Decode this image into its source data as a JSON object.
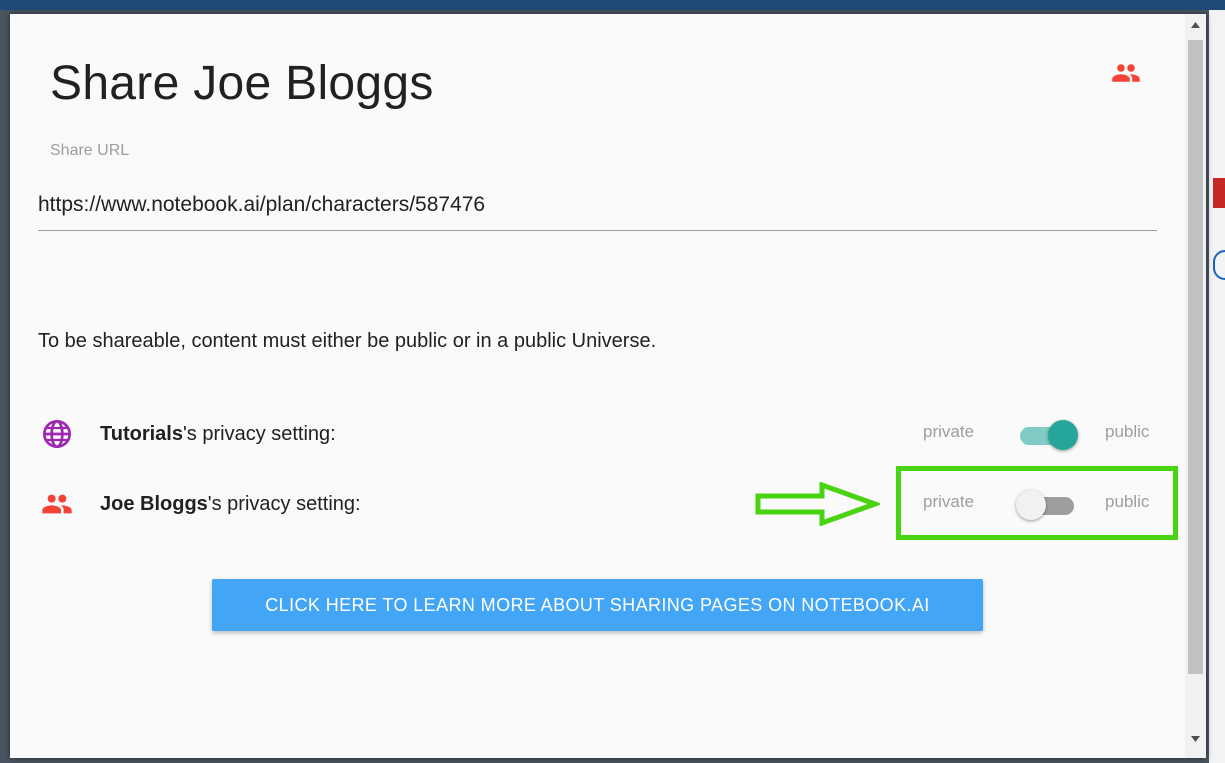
{
  "modal": {
    "title": "Share Joe Bloggs",
    "header_icon": "people-icon",
    "share_url_label": "Share URL",
    "share_url_value": "https://www.notebook.ai/plan/characters/587476",
    "notice": "To be shareable, content must either be public or in a public Universe.",
    "rows": [
      {
        "icon": "globe-icon",
        "name": "Tutorials",
        "suffix": "'s privacy setting:",
        "private_label": "private",
        "public_label": "public",
        "state": "public"
      },
      {
        "icon": "people-icon",
        "name": "Joe Bloggs",
        "suffix": "'s privacy setting:",
        "private_label": "private",
        "public_label": "public",
        "state": "private"
      }
    ],
    "learn_button": "CLICK HERE TO LEARN MORE ABOUT SHARING PAGES ON NOTEBOOK.AI"
  },
  "colors": {
    "accent_teal": "#26a69a",
    "button_blue": "#42a5f5",
    "people_red": "#f44336",
    "globe_purple": "#9c27b0",
    "annotation_green": "#49d412"
  }
}
